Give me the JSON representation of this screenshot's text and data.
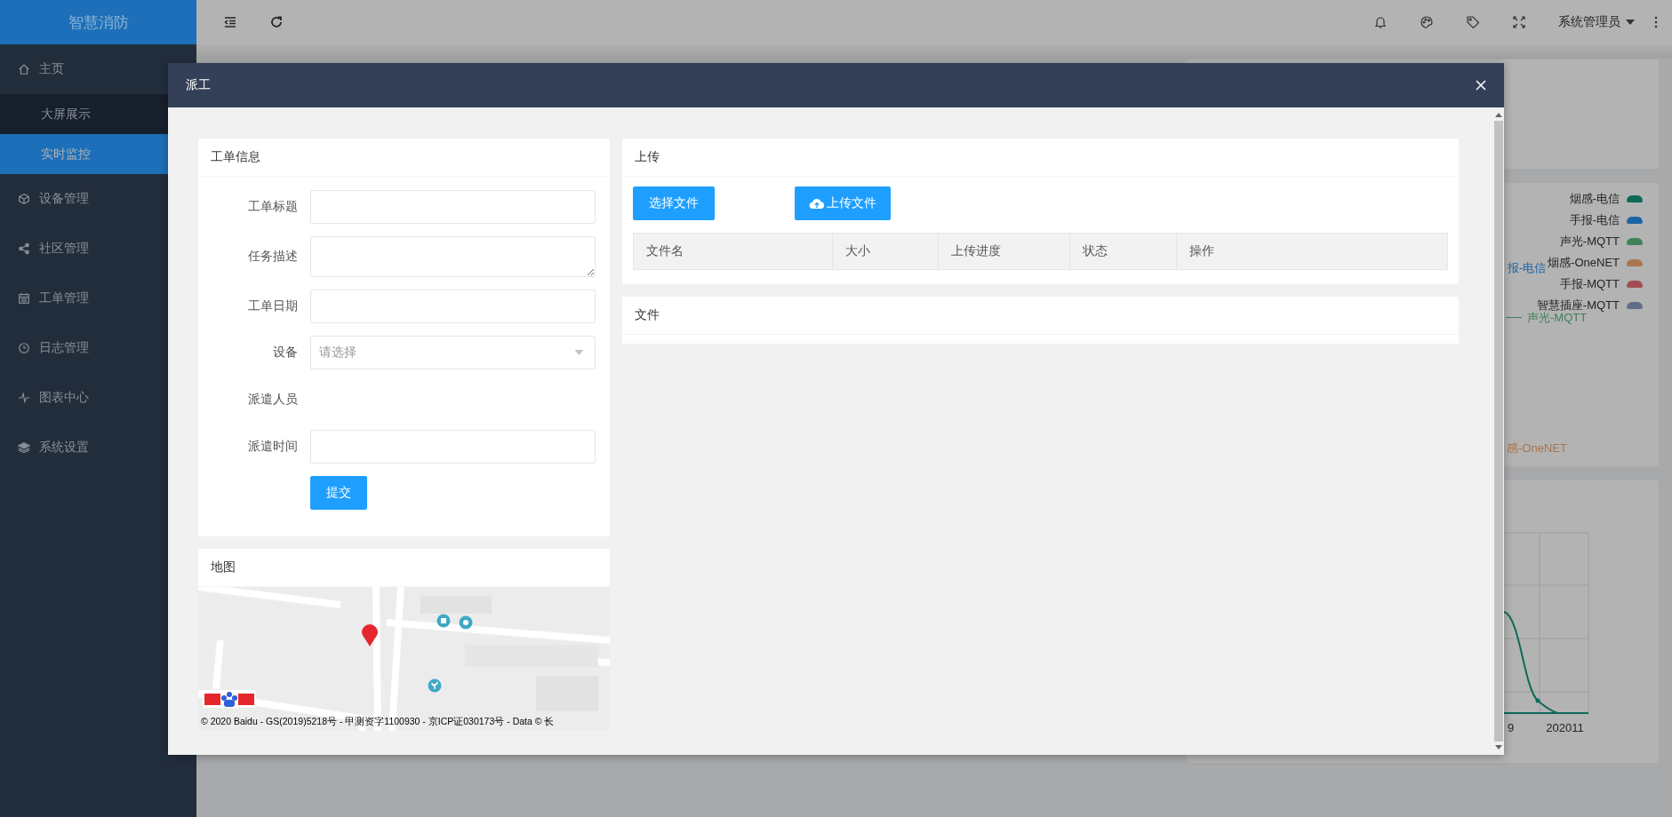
{
  "sidebar": {
    "logo": "智慧消防",
    "items": [
      {
        "label": "主页",
        "selected": false,
        "children": [
          {
            "label": "大屏展示",
            "selected": false
          },
          {
            "label": "实时监控",
            "selected": true
          }
        ]
      },
      {
        "label": "设备管理",
        "selected": false
      },
      {
        "label": "社区管理",
        "selected": false
      },
      {
        "label": "工单管理",
        "selected": false
      },
      {
        "label": "日志管理",
        "selected": false
      },
      {
        "label": "图表中心",
        "selected": false
      },
      {
        "label": "系统设置",
        "selected": false
      }
    ]
  },
  "header": {
    "user": "系统管理员"
  },
  "dashboard": {
    "legend": [
      {
        "label": "烟感-电信",
        "color": "#0d6a59"
      },
      {
        "label": "手报-电信",
        "color": "#1a65a4"
      },
      {
        "label": "声光-MQTT",
        "color": "#3f8258"
      },
      {
        "label": "烟感-OneNET",
        "color": "#a97650"
      },
      {
        "label": "手报-MQTT",
        "color": "#a04e51"
      },
      {
        "label": "智慧插座-MQTT",
        "color": "#616d88"
      }
    ],
    "pie_labels": [
      {
        "text": "报-电信",
        "color": "#1a65a4"
      },
      {
        "text": "声光-MQTT",
        "color": "#3f8258"
      },
      {
        "text": "感-OneNET",
        "color": "#a97650"
      }
    ],
    "trend_x_labels": [
      "9",
      "202011"
    ]
  },
  "modal": {
    "title": "派工",
    "order_card": {
      "title": "工单信息",
      "fields": [
        {
          "label": "工单标题",
          "kind": "input"
        },
        {
          "label": "任务描述",
          "kind": "textarea"
        },
        {
          "label": "工单日期",
          "kind": "input"
        },
        {
          "label": "设备",
          "kind": "select",
          "placeholder": "请选择"
        },
        {
          "label": "派遣人员",
          "kind": "label"
        },
        {
          "label": "派遣时间",
          "kind": "input"
        }
      ],
      "submit": "提交"
    },
    "map_card": {
      "title": "地图",
      "copyright": "© 2020 Baidu - GS(2019)5218号 - 甲测资字1100930 - 京ICP证030173号 - Data © 长"
    },
    "upload_card": {
      "title": "上传",
      "choose_button": "选择文件",
      "upload_button": "上传文件",
      "columns": [
        "文件名",
        "大小",
        "上传进度",
        "状态",
        "操作"
      ]
    },
    "files_card": {
      "title": "文件"
    }
  }
}
